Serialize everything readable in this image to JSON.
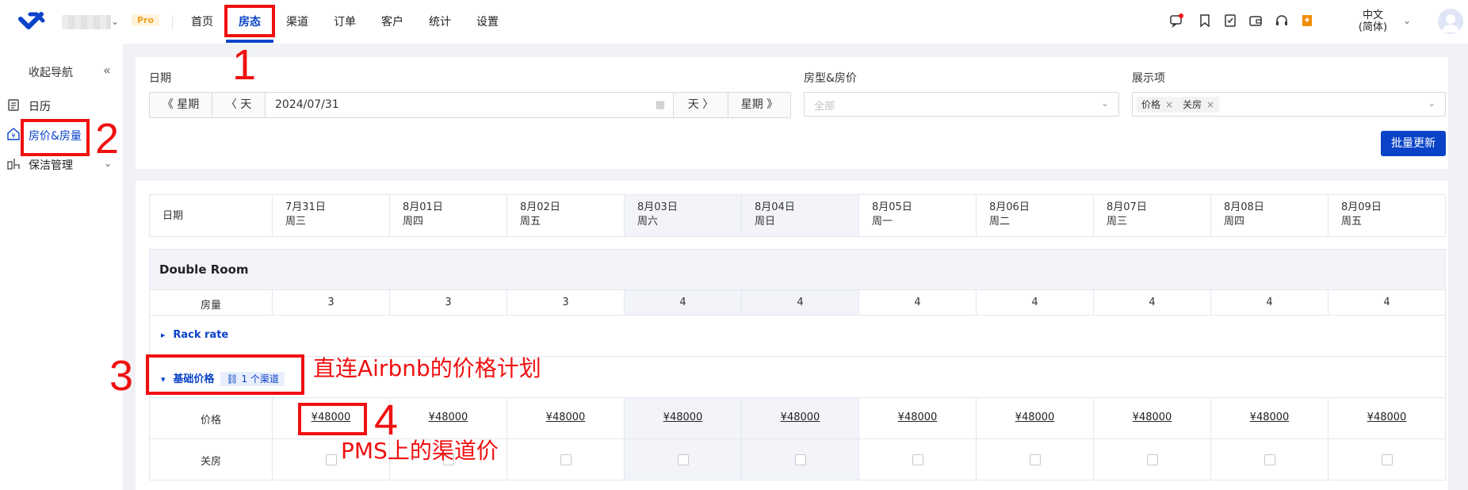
{
  "topbar": {
    "pro_badge": "Pro",
    "nav": [
      "首页",
      "房态",
      "渠道",
      "订单",
      "客户",
      "统计",
      "设置"
    ],
    "active_nav": "房态",
    "icons": [
      "message-icon",
      "bookmark-icon",
      "checklist-icon",
      "wallet-icon",
      "headset-icon",
      "notebook-icon"
    ],
    "lang_line1": "中文",
    "lang_line2": "(简体)"
  },
  "sidebar": {
    "collapse_label": "收起导航",
    "items": [
      {
        "label": "日历",
        "icon": "calendar-icon",
        "active": false
      },
      {
        "label": "房价&房量",
        "icon": "price-tag-icon",
        "active": true
      },
      {
        "label": "保洁管理",
        "icon": "cleaning-icon",
        "active": false,
        "expandable": true
      }
    ]
  },
  "filters": {
    "date_label": "日期",
    "prev_week": "《 星期",
    "prev_day": "〈 天",
    "date_value": "2024/07/31",
    "next_day": "天 〉",
    "next_week": "星期 》",
    "room_label": "房型&房价",
    "room_placeholder": "全部",
    "display_label": "展示项",
    "display_tags": [
      "价格",
      "关房"
    ],
    "batch_update": "批量更新"
  },
  "grid": {
    "date_header": "日期",
    "dates": [
      {
        "date": "7月31日",
        "weekday": "周三",
        "weekend": false
      },
      {
        "date": "8月01日",
        "weekday": "周四",
        "weekend": false
      },
      {
        "date": "8月02日",
        "weekday": "周五",
        "weekend": false
      },
      {
        "date": "8月03日",
        "weekday": "周六",
        "weekend": true
      },
      {
        "date": "8月04日",
        "weekday": "周日",
        "weekend": true
      },
      {
        "date": "8月05日",
        "weekday": "周一",
        "weekend": false
      },
      {
        "date": "8月06日",
        "weekday": "周二",
        "weekend": false
      },
      {
        "date": "8月07日",
        "weekday": "周三",
        "weekend": false
      },
      {
        "date": "8月08日",
        "weekday": "周四",
        "weekend": false
      },
      {
        "date": "8月09日",
        "weekday": "周五",
        "weekend": false
      }
    ],
    "room_type": "Double Room",
    "inventory_label": "房量",
    "inventory": [
      "3",
      "3",
      "3",
      "4",
      "4",
      "4",
      "4",
      "4",
      "4",
      "4"
    ],
    "rate_plans": [
      {
        "name": "Rack rate",
        "expanded": false
      },
      {
        "name": "基础价格",
        "expanded": true,
        "channel_tag": "1 个渠道"
      }
    ],
    "price_label": "价格",
    "prices": [
      "¥48000",
      "¥48000",
      "¥48000",
      "¥48000",
      "¥48000",
      "¥48000",
      "¥48000",
      "¥48000",
      "¥48000",
      "¥48000"
    ],
    "close_label": "关房"
  },
  "annotations": {
    "nums": [
      "1",
      "2",
      "3",
      "4"
    ],
    "note3": "直连Airbnb的价格计划",
    "note4": "PMS上的渠道价",
    "color": "#f01010"
  }
}
